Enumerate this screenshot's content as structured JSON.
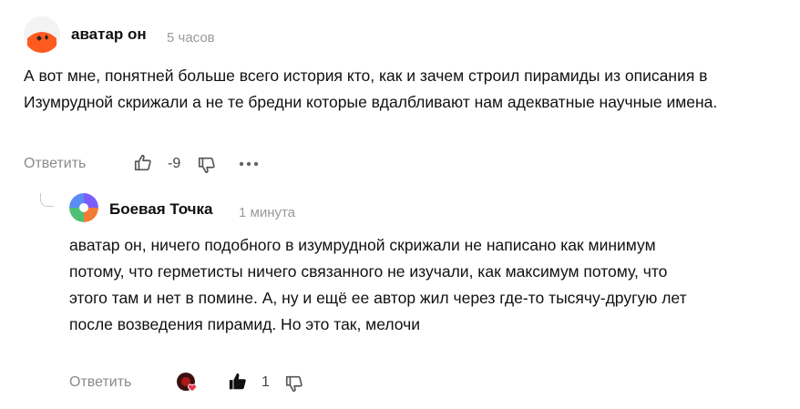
{
  "comment1": {
    "author": "аватар он",
    "time": "5 часов",
    "text": "А вот мне, понятней больше всего история кто, как и зачем строил пирамиды из описания в Изумрудной скрижали а не те бредни которые вдалбливают нам адекватные научные имена.",
    "reply_label": "Ответить",
    "score": "-9",
    "icons": {
      "like": "thumb-up-outline-icon",
      "dislike": "thumb-down-outline-icon",
      "more": "more-dots-icon"
    }
  },
  "reply": {
    "author": "Боевая Точка",
    "time": "1 минута",
    "text": "аватар он, ничего подобного в изумрудной скрижали не написано как минимум потому, что герметисты ничего связанного не изучали, как максимум потому, что этого там и нет в помине. А, ну и ещё ее автор жил через где-то тысячу-другую лет после возведения пирамид. Но это так, мелочи",
    "reply_label": "Ответить",
    "score": "1",
    "icons": {
      "reaction": "reaction-avatar-heart-icon",
      "like": "thumb-up-filled-icon",
      "dislike": "thumb-down-outline-icon"
    }
  },
  "colors": {
    "accent_orange": "#ff5a1f",
    "muted": "#8a8a8a",
    "text": "#111111"
  }
}
